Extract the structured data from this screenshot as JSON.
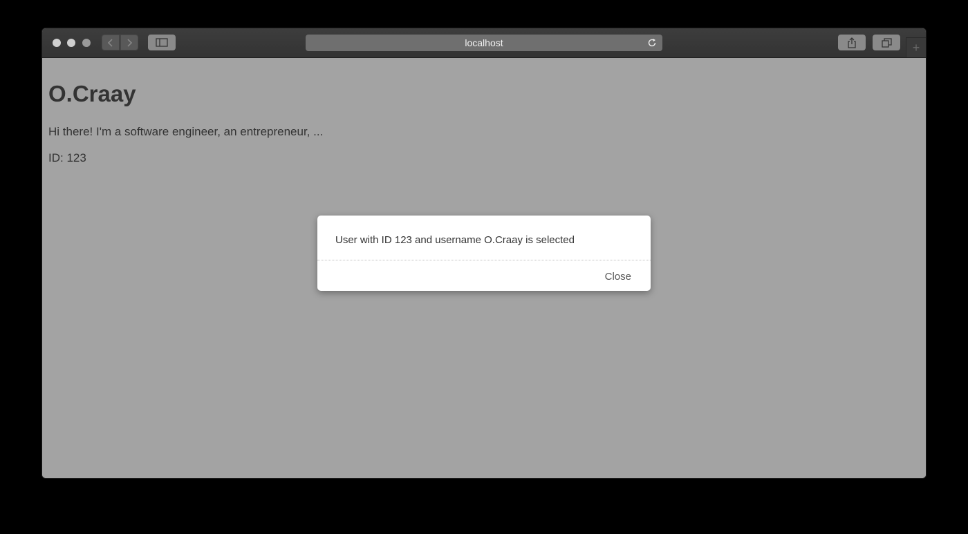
{
  "browser": {
    "url": "localhost",
    "icons": {
      "back": "chevron-left-icon",
      "forward": "chevron-right-icon",
      "sidebar": "sidebar-icon",
      "reload": "reload-icon",
      "share": "share-icon",
      "tabs": "tabs-overview-icon",
      "new_tab": "plus-icon"
    },
    "new_tab_glyph": "+"
  },
  "page": {
    "title": "O.Craay",
    "bio": "Hi there! I'm a software engineer, an entrepreneur, ...",
    "id_text": "ID: 123"
  },
  "dialog": {
    "message": "User with ID 123 and username O.Craay is selected",
    "close_label": "Close"
  }
}
